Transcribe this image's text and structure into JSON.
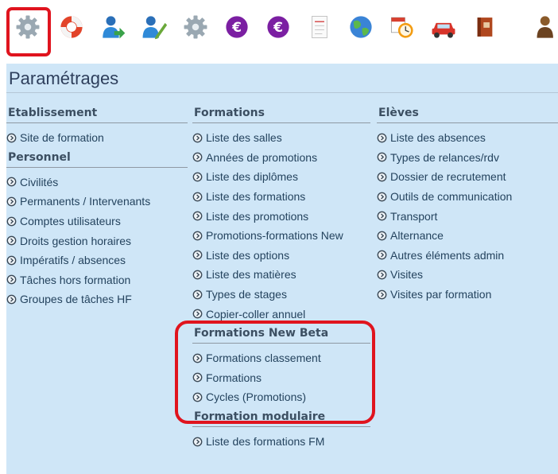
{
  "toolbar": {
    "icons": [
      "gear-icon",
      "lifebuoy-icon",
      "user-arrow-icon",
      "user-pencil-icon",
      "gear-icon",
      "euro-icon",
      "euro-icon",
      "notepad-icon",
      "globe-icon",
      "alarm-calendar-icon",
      "car-icon",
      "book-icon",
      "person-icon"
    ],
    "colors": {
      "highlight": "#e0141e",
      "euro": "#7b1fa2",
      "gear": "#9aa8b2"
    }
  },
  "page": {
    "title": "Paramétrages"
  },
  "columns": {
    "etablissement": {
      "header": "Etablissement",
      "items": [
        "Site de formation"
      ]
    },
    "personnel": {
      "header": "Personnel",
      "items": [
        "Civilités",
        "Permanents / Intervenants",
        "Comptes utilisateurs",
        "Droits gestion horaires",
        "Impératifs / absences",
        "Tâches hors formation",
        "Groupes de tâches HF"
      ]
    },
    "formations": {
      "header": "Formations",
      "items": [
        "Liste des salles",
        "Années de promotions",
        "Liste des diplômes",
        "Liste des formations",
        "Liste des promotions",
        "Promotions-formations New",
        "Liste des options",
        "Liste des matières",
        "Types de stages",
        "Copier-coller annuel"
      ]
    },
    "formations_beta": {
      "header": "Formations New Beta",
      "items": [
        "Formations classement",
        "Formations",
        "Cycles (Promotions)"
      ]
    },
    "formation_modulaire": {
      "header": "Formation modulaire",
      "items": [
        "Liste des formations FM"
      ]
    },
    "eleves": {
      "header": "Elèves",
      "items": [
        "Liste des absences",
        "Types de relances/rdv",
        "Dossier de recrutement",
        "Outils de communication",
        "Transport",
        "Alternance",
        "Autres éléments admin",
        "Visites",
        "Visites par formation"
      ]
    }
  }
}
